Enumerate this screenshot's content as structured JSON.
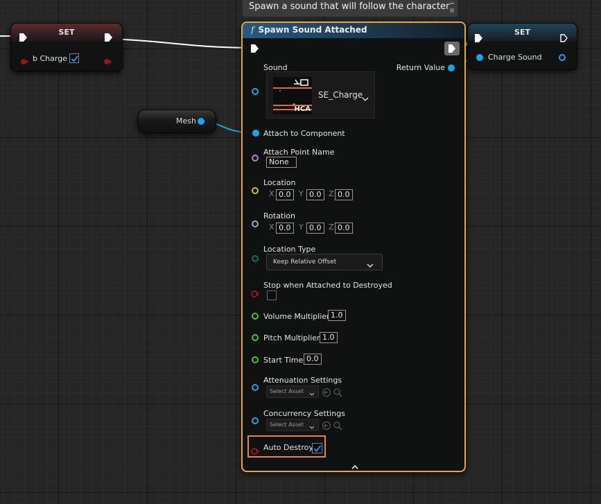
{
  "comment": {
    "text": "Spawn a sound that will follow the character"
  },
  "set_node_left": {
    "title": "SET",
    "pin_label": "b Charge",
    "checked": true
  },
  "set_node_right": {
    "title": "SET",
    "pin_label": "Charge Sound"
  },
  "mesh_node": {
    "label": "Mesh"
  },
  "spawn_node": {
    "title": "Spawn Sound Attached",
    "return_label": "Return Value",
    "sound": {
      "label": "Sound",
      "asset_name": "SE_Charge",
      "thumb_text": "HCA"
    },
    "attach_to_component": "Attach to Component",
    "attach_point_name": {
      "label": "Attach Point Name",
      "value": "None"
    },
    "location": {
      "label": "Location",
      "x": "0.0",
      "y": "0.0",
      "z": "0.0"
    },
    "rotation": {
      "label": "Rotation",
      "x": "0.0",
      "y": "0.0",
      "z": "0.0"
    },
    "axis_labels": {
      "x": "X",
      "y": "Y",
      "z": "Z"
    },
    "location_type": {
      "label": "Location Type",
      "value": "Keep Relative Offset"
    },
    "stop_when_attached_to_destroyed": {
      "label": "Stop when Attached to Destroyed",
      "checked": false
    },
    "volume_multiplier": {
      "label": "Volume Multiplier",
      "value": "1.0"
    },
    "pitch_multiplier": {
      "label": "Pitch Multiplier",
      "value": "1.0"
    },
    "start_time": {
      "label": "Start Time",
      "value": "0.0"
    },
    "attenuation_settings": {
      "label": "Attenuation Settings",
      "placeholder": "Select Asset"
    },
    "concurrency_settings": {
      "label": "Concurrency Settings",
      "placeholder": "Select Asset"
    },
    "auto_destroy": {
      "label": "Auto Destroy",
      "checked": true
    }
  },
  "colors": {
    "background": "#262626",
    "selected_outline": "#e8a73a",
    "highlight_box": "#e8834e",
    "object_pin": "#1ca4ea",
    "bool_pin": "#9b1616",
    "name_pin": "#c07bdc",
    "vector_pin": "#e0b635",
    "rotator_pin": "#95a9d8",
    "enum_pin": "#0a6e6a",
    "float_pin": "#3ec73e"
  }
}
